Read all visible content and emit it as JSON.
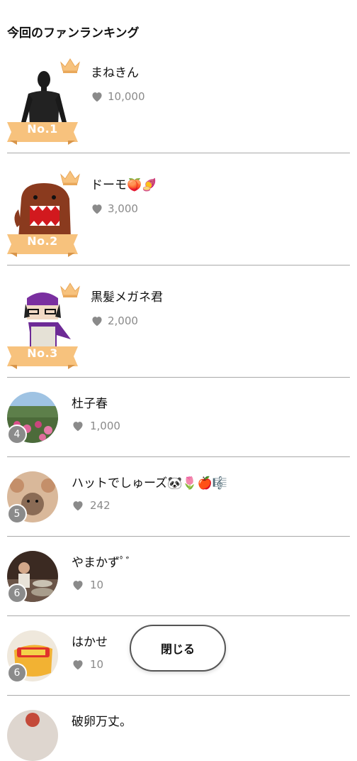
{
  "title": "今回のファンランキング",
  "top_fans": [
    {
      "rank_label": "No.1",
      "name": "まねきん",
      "count": "10,000"
    },
    {
      "rank_label": "No.2",
      "name": "ドーモ🍑🍠",
      "count": "3,000"
    },
    {
      "rank_label": "No.3",
      "name": "黒髪メガネ君",
      "count": "2,000"
    }
  ],
  "fans": [
    {
      "rank": "4",
      "name": "杜子春",
      "count": "1,000"
    },
    {
      "rank": "5",
      "name": "ハットでしゅーズ🐼🌷🍎🎼",
      "count": "242"
    },
    {
      "rank": "6",
      "name": "やまかずﾟﾞ",
      "count": "10"
    },
    {
      "rank": "6",
      "name": "はかせ",
      "count": "10"
    },
    {
      "rank": "",
      "name": "破卵万丈。",
      "count": ""
    }
  ],
  "close_label": "閉じる",
  "colors": {
    "ribbon": "#f7c27d",
    "ribbon_dark": "#e9a85a",
    "heart": "#8a8a8a",
    "badge": "#8b8b8b"
  }
}
